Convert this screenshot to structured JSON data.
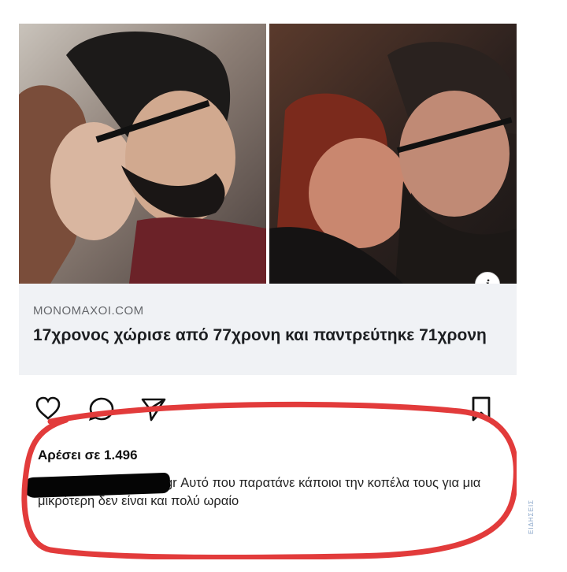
{
  "post": {
    "info_icon_glyph": "i",
    "link_domain": "MONOMAXOI.COM",
    "link_title": "17χρονος χώρισε από 77χρονη και παντρεύτηκε 71χρονη",
    "likes_text": "Αρέσει σε 1.496",
    "comment_text": "gr Αυτό που παρατάνε κάποιοι την κοπέλα τους για μια μικρότερη δεν είναι και πολύ ωραίο",
    "watermark_text": "ΕΙΔΗΣΕΙΣ"
  },
  "icons": {
    "like": "heart-icon",
    "comment": "comment-icon",
    "share": "send-icon",
    "save": "bookmark-icon",
    "info": "info-icon"
  },
  "colors": {
    "annotation_circle": "#e23b3b",
    "link_preview_bg": "#f0f2f5",
    "headline_text": "#1c1e21",
    "domain_text": "#65676b"
  }
}
